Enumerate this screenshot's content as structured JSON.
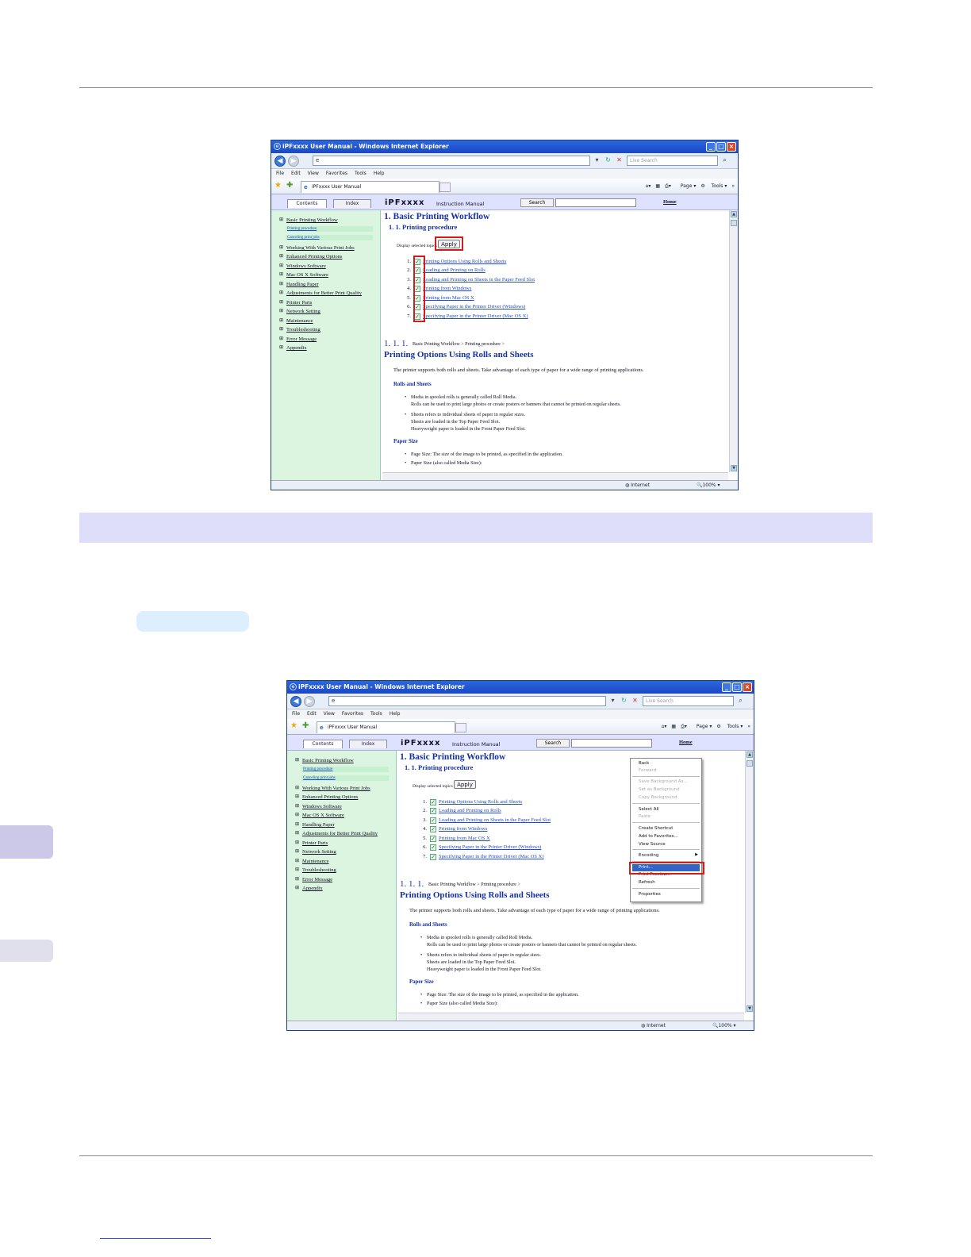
{
  "browser": {
    "title": "iPFxxxx User Manual - Windows Internet Explorer",
    "search_placeholder": "Live Search",
    "menu": [
      "File",
      "Edit",
      "View",
      "Favorites",
      "Tools",
      "Help"
    ],
    "tab_label": "iPFxxxx User Manual",
    "cmd_page": "Page",
    "cmd_tools": "Tools",
    "status_zone": "Internet",
    "zoom": "100%"
  },
  "manual": {
    "tab_contents": "Contents",
    "tab_index": "Index",
    "brand": "iPFxxxx",
    "instruction_manual": "Instruction Manual",
    "search_button": "Search",
    "home_link": "Home",
    "toc": [
      "Basic Printing Workflow",
      "Working With Various Print Jobs",
      "Enhanced Printing Options",
      "Windows Software",
      "Mac OS X Software",
      "Handling Paper",
      "Adjustments for Better Print Quality",
      "Printer Parts",
      "Network Setting",
      "Maintenance",
      "Troubleshooting",
      "Error Message",
      "Appendix"
    ],
    "toc_sub": [
      "Printing procedure",
      "Canceling print jobs"
    ],
    "heading": "1. Basic Printing Workflow",
    "subheading": "1. 1. Printing procedure",
    "display_selected": "Display selected topics",
    "apply": "Apply",
    "topics": [
      {
        "n": "1.",
        "label": "Printing Options Using Rolls and Sheets"
      },
      {
        "n": "2.",
        "label": "Loading and Printing on Rolls"
      },
      {
        "n": "3.",
        "label": "Loading and Printing on Sheets in the Paper Feed Slot"
      },
      {
        "n": "4.",
        "label": "Printing from Windows"
      },
      {
        "n": "5.",
        "label": "Printing from Mac OS X"
      },
      {
        "n": "6.",
        "label": "Specifying Paper in the Printer Driver (Windows)"
      },
      {
        "n": "7.",
        "label": "Specifying Paper in the Printer Driver (Mac OS X)"
      }
    ],
    "section_num": "1. 1. 1.",
    "breadcrumb": "Basic Printing Workflow > Printing procedure >",
    "section_title": "Printing Options Using Rolls and Sheets",
    "intro": "The printer supports both rolls and sheets. Take advantage of each type of paper for a wide range of printing applications.",
    "rolls_heading": "Rolls and Sheets",
    "bullet1_a": "Media in spooled rolls is generally called Roll Media.",
    "bullet1_b": "Rolls can be used to print large photos or create posters or banners that cannot be printed on regular sheets.",
    "bullet2_a": "Sheets refers to individual sheets of paper in regular sizes.",
    "bullet2_b": "Sheets are loaded in the Top Paper Feed Slot.",
    "bullet2_c": "Heavyweight paper is loaded in the Front Paper Feed Slot.",
    "paper_size_heading": "Paper Size",
    "bullet3": "Page Size: The size of the image to be printed, as specified in the application.",
    "bullet4": "Paper Size (also called Media Size):"
  },
  "context_menu": {
    "back": "Back",
    "forward": "Forward",
    "save_bg": "Save Background As...",
    "set_bg": "Set as Background",
    "copy_bg": "Copy Background",
    "select_all": "Select All",
    "paste": "Paste",
    "create_shortcut": "Create Shortcut",
    "add_favorites": "Add to Favorites...",
    "view_source": "View Source",
    "encoding": "Encoding",
    "print": "Print...",
    "print_preview": "Print Preview...",
    "refresh": "Refresh",
    "properties": "Properties"
  },
  "colors": {
    "band": "#dedefa",
    "side_tab_dark": "#ccc8e8",
    "side_tab_light": "#e0e0ec",
    "highlight_red": "#d41b1b"
  }
}
